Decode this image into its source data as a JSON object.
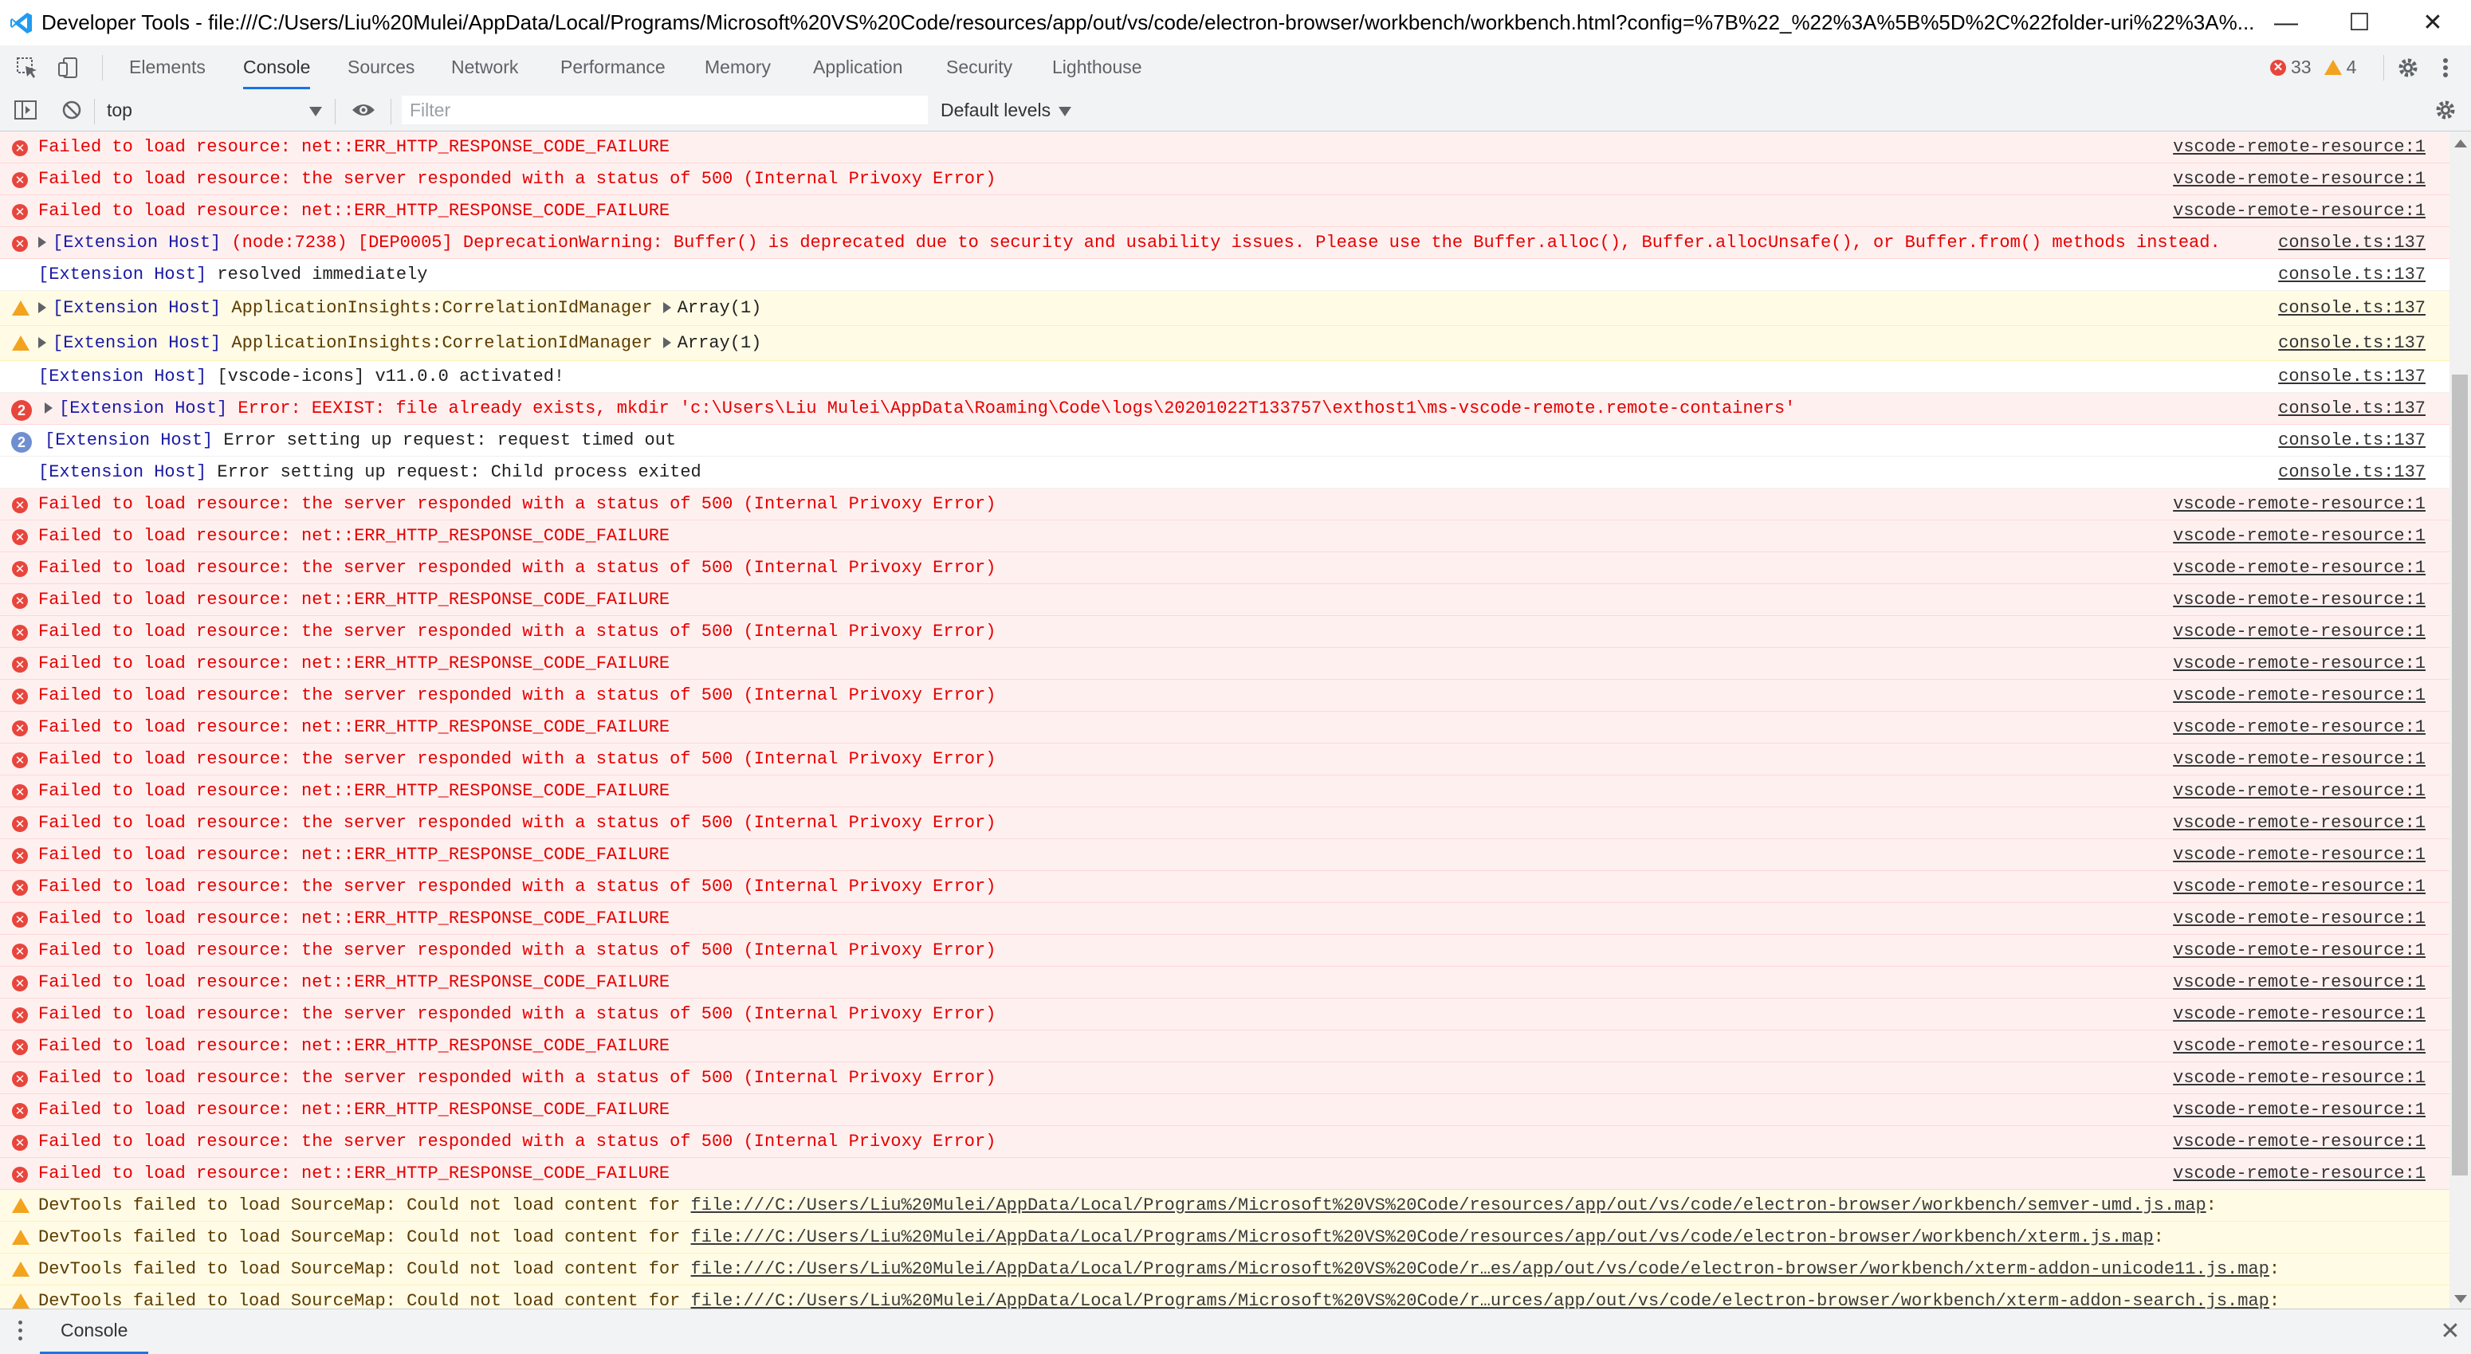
{
  "window": {
    "title": "Developer Tools - file:///C:/Users/Liu%20Mulei/AppData/Local/Programs/Microsoft%20VS%20Code/resources/app/out/vs/code/electron-browser/workbench/workbench.html?config=%7B%22_%22%3A%5B%5D%2C%22folder-uri%22%3A%...",
    "minimize": "—",
    "maximize": "☐",
    "close": "✕"
  },
  "tabs": [
    "Elements",
    "Console",
    "Sources",
    "Network",
    "Performance",
    "Memory",
    "Application",
    "Security",
    "Lighthouse"
  ],
  "counts": {
    "errors": "33",
    "warnings": "4"
  },
  "toolbar": {
    "context": "top",
    "filter_placeholder": "Filter",
    "levels": "Default levels"
  },
  "colors": {
    "error_bg": "#fff0f0",
    "error_text": "#e50000",
    "warn_bg": "#fffbe5",
    "accent": "#1a73e8",
    "badge_blue": "#6f8fd1"
  },
  "messages": [
    {
      "level": "error",
      "text": "Failed to load resource: net::ERR_HTTP_RESPONSE_CODE_FAILURE",
      "source": "vscode-remote-resource:1"
    },
    {
      "level": "error",
      "text": "Failed to load resource: the server responded with a status of 500 (Internal Privoxy Error)",
      "source": "vscode-remote-resource:1"
    },
    {
      "level": "error",
      "text": "Failed to load resource: net::ERR_HTTP_RESPONSE_CODE_FAILURE",
      "source": "vscode-remote-resource:1"
    },
    {
      "level": "error",
      "expand": true,
      "tag": "[Extension Host]",
      "text": " (node:7238) [DEP0005] DeprecationWarning: Buffer() is deprecated due to security and usability issues. Please use the Buffer.alloc(), Buffer.allocUnsafe(), or Buffer.from() methods instead.",
      "source": "console.ts:137"
    },
    {
      "level": "info",
      "tag": "[Extension Host]",
      "text": " resolved immediately",
      "source": "console.ts:137"
    },
    {
      "level": "warn",
      "expand": true,
      "tag": "[Extension Host]",
      "text": " ApplicationInsights:CorrelationIdManager ",
      "array": "Array(1)",
      "source": "console.ts:137"
    },
    {
      "level": "warn",
      "expand": true,
      "tag": "[Extension Host]",
      "text": " ApplicationInsights:CorrelationIdManager ",
      "array": "Array(1)",
      "source": "console.ts:137"
    },
    {
      "level": "info",
      "tag": "[Extension Host]",
      "text": " [vscode-icons] v11.0.0 activated!",
      "source": "console.ts:137"
    },
    {
      "level": "error",
      "badge": "2",
      "expand": true,
      "tag": "[Extension Host]",
      "text": " Error: EEXIST: file already exists, mkdir 'c:\\Users\\Liu Mulei\\AppData\\Roaming\\Code\\logs\\20201022T133757\\exthost1\\ms-vscode-remote.remote-containers'",
      "source": "console.ts:137"
    },
    {
      "level": "info",
      "badge": "2",
      "tag": "[Extension Host]",
      "text": " Error setting up request: request timed out",
      "source": "console.ts:137"
    },
    {
      "level": "info",
      "tag": "[Extension Host]",
      "text": " Error setting up request: Child process exited",
      "source": "console.ts:137"
    },
    {
      "level": "error",
      "text": "Failed to load resource: the server responded with a status of 500 (Internal Privoxy Error)",
      "source": "vscode-remote-resource:1"
    },
    {
      "level": "error",
      "text": "Failed to load resource: net::ERR_HTTP_RESPONSE_CODE_FAILURE",
      "source": "vscode-remote-resource:1"
    },
    {
      "level": "error",
      "text": "Failed to load resource: the server responded with a status of 500 (Internal Privoxy Error)",
      "source": "vscode-remote-resource:1"
    },
    {
      "level": "error",
      "text": "Failed to load resource: net::ERR_HTTP_RESPONSE_CODE_FAILURE",
      "source": "vscode-remote-resource:1"
    },
    {
      "level": "error",
      "text": "Failed to load resource: the server responded with a status of 500 (Internal Privoxy Error)",
      "source": "vscode-remote-resource:1"
    },
    {
      "level": "error",
      "text": "Failed to load resource: net::ERR_HTTP_RESPONSE_CODE_FAILURE",
      "source": "vscode-remote-resource:1"
    },
    {
      "level": "error",
      "text": "Failed to load resource: the server responded with a status of 500 (Internal Privoxy Error)",
      "source": "vscode-remote-resource:1"
    },
    {
      "level": "error",
      "text": "Failed to load resource: net::ERR_HTTP_RESPONSE_CODE_FAILURE",
      "source": "vscode-remote-resource:1"
    },
    {
      "level": "error",
      "text": "Failed to load resource: the server responded with a status of 500 (Internal Privoxy Error)",
      "source": "vscode-remote-resource:1"
    },
    {
      "level": "error",
      "text": "Failed to load resource: net::ERR_HTTP_RESPONSE_CODE_FAILURE",
      "source": "vscode-remote-resource:1"
    },
    {
      "level": "error",
      "text": "Failed to load resource: the server responded with a status of 500 (Internal Privoxy Error)",
      "source": "vscode-remote-resource:1"
    },
    {
      "level": "error",
      "text": "Failed to load resource: net::ERR_HTTP_RESPONSE_CODE_FAILURE",
      "source": "vscode-remote-resource:1"
    },
    {
      "level": "error",
      "text": "Failed to load resource: the server responded with a status of 500 (Internal Privoxy Error)",
      "source": "vscode-remote-resource:1"
    },
    {
      "level": "error",
      "text": "Failed to load resource: net::ERR_HTTP_RESPONSE_CODE_FAILURE",
      "source": "vscode-remote-resource:1"
    },
    {
      "level": "error",
      "text": "Failed to load resource: the server responded with a status of 500 (Internal Privoxy Error)",
      "source": "vscode-remote-resource:1"
    },
    {
      "level": "error",
      "text": "Failed to load resource: net::ERR_HTTP_RESPONSE_CODE_FAILURE",
      "source": "vscode-remote-resource:1"
    },
    {
      "level": "error",
      "text": "Failed to load resource: the server responded with a status of 500 (Internal Privoxy Error)",
      "source": "vscode-remote-resource:1"
    },
    {
      "level": "error",
      "text": "Failed to load resource: net::ERR_HTTP_RESPONSE_CODE_FAILURE",
      "source": "vscode-remote-resource:1"
    },
    {
      "level": "error",
      "text": "Failed to load resource: the server responded with a status of 500 (Internal Privoxy Error)",
      "source": "vscode-remote-resource:1"
    },
    {
      "level": "error",
      "text": "Failed to load resource: net::ERR_HTTP_RESPONSE_CODE_FAILURE",
      "source": "vscode-remote-resource:1"
    },
    {
      "level": "error",
      "text": "Failed to load resource: the server responded with a status of 500 (Internal Privoxy Error)",
      "source": "vscode-remote-resource:1"
    },
    {
      "level": "error",
      "text": "Failed to load resource: net::ERR_HTTP_RESPONSE_CODE_FAILURE",
      "source": "vscode-remote-resource:1"
    },
    {
      "level": "warn",
      "text": "DevTools failed to load SourceMap: Could not load content for ",
      "link": "file:///C:/Users/Liu%20Mulei/AppData/Local/Programs/Microsoft%20VS%20Code/resources/app/out/vs/code/electron-browser/workbench/semver-umd.js.map",
      "suffix": ":"
    },
    {
      "level": "warn",
      "text": "DevTools failed to load SourceMap: Could not load content for ",
      "link": "file:///C:/Users/Liu%20Mulei/AppData/Local/Programs/Microsoft%20VS%20Code/resources/app/out/vs/code/electron-browser/workbench/xterm.js.map",
      "suffix": ":"
    },
    {
      "level": "warn",
      "text": "DevTools failed to load SourceMap: Could not load content for ",
      "link": "file:///C:/Users/Liu%20Mulei/AppData/Local/Programs/Microsoft%20VS%20Code/r…es/app/out/vs/code/electron-browser/workbench/xterm-addon-unicode11.js.map",
      "suffix": ":"
    },
    {
      "level": "warn",
      "text": "DevTools failed to load SourceMap: Could not load content for ",
      "link": "file:///C:/Users/Liu%20Mulei/AppData/Local/Programs/Microsoft%20VS%20Code/r…urces/app/out/vs/code/electron-browser/workbench/xterm-addon-search.js.map",
      "suffix": ":"
    }
  ],
  "drawer": {
    "tab": "Console",
    "close": "✕"
  }
}
